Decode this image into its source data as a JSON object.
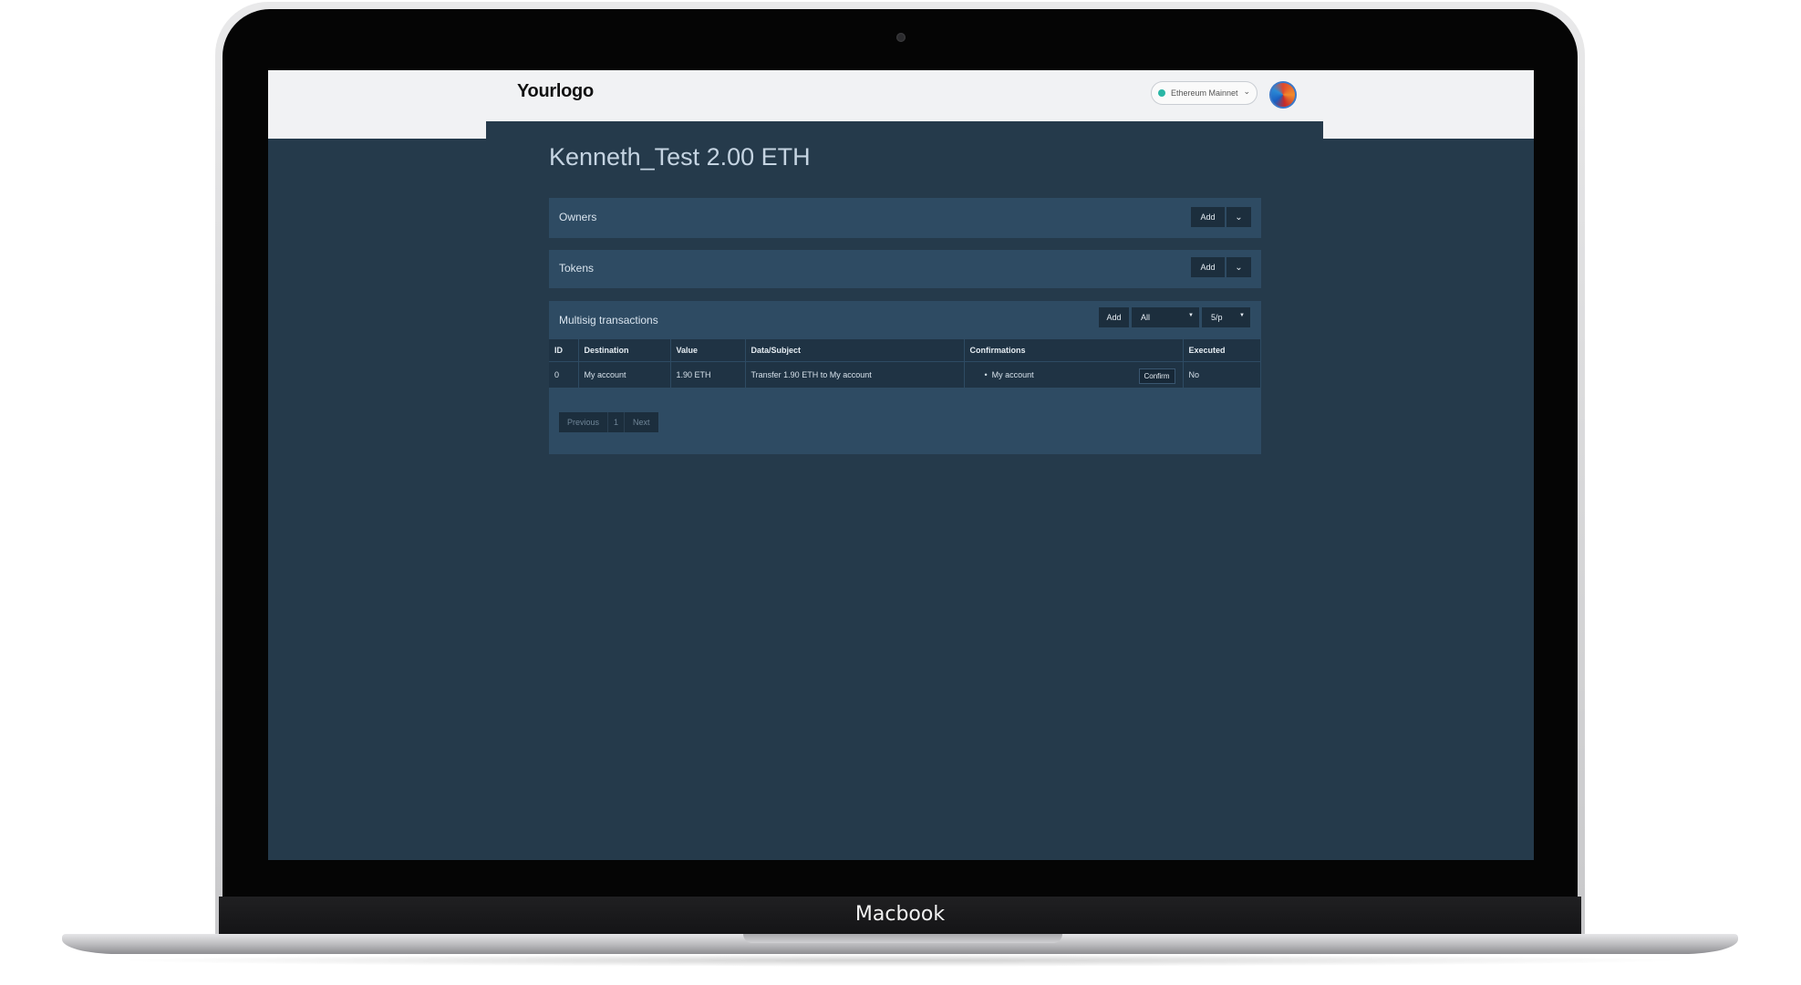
{
  "device": {
    "brand_label": "Macbook"
  },
  "header": {
    "logo": "Yourlogo",
    "network": "Ethereum Mainnet"
  },
  "wallet": {
    "title": "Kenneth_Test 2.00 ETH"
  },
  "owners": {
    "title": "Owners",
    "add_label": "Add"
  },
  "tokens": {
    "title": "Tokens",
    "add_label": "Add"
  },
  "multisig": {
    "title": "Multisig transactions",
    "add_label": "Add",
    "filter_value": "All",
    "per_page_value": "5/p",
    "columns": [
      "ID",
      "Destination",
      "Value",
      "Data/Subject",
      "Confirmations",
      "Executed"
    ],
    "rows": [
      {
        "id": "0",
        "destination": "My account",
        "value": "1.90 ETH",
        "data": "Transfer 1.90 ETH to My account",
        "confirmation": "My account",
        "confirm_label": "Confirm",
        "executed": "No"
      }
    ],
    "pagination": {
      "previous": "Previous",
      "page": "1",
      "next": "Next"
    }
  }
}
